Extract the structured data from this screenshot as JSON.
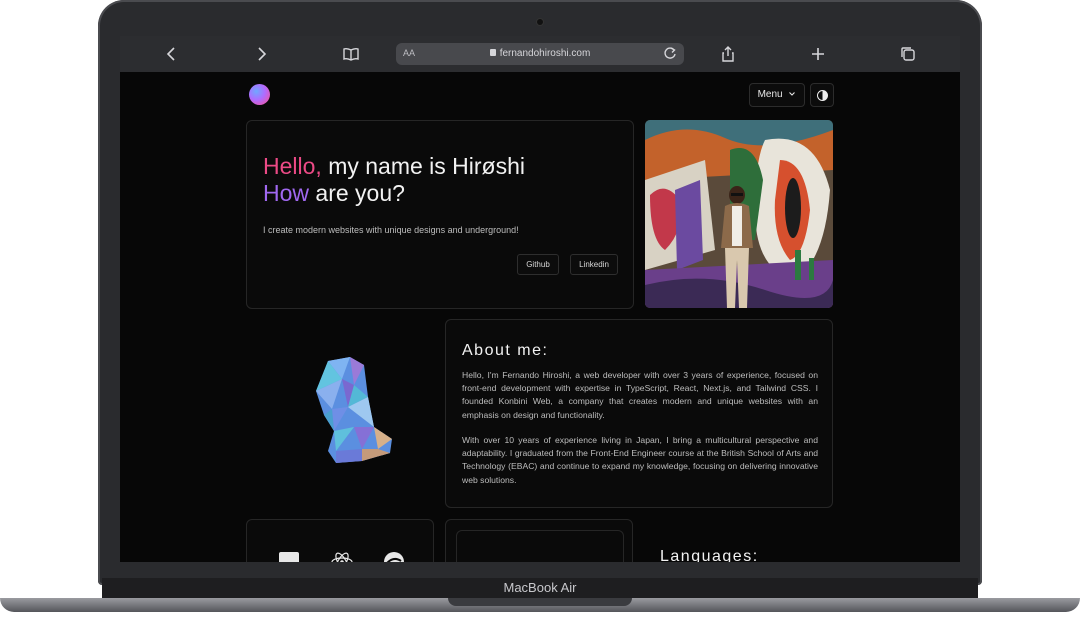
{
  "device": {
    "label": "MacBook Air"
  },
  "browser": {
    "text_size_label": "AA",
    "url": "fernandohiroshi.com",
    "icons": [
      "chevron-left-icon",
      "chevron-right-icon",
      "book-icon",
      "lock-icon",
      "reload-icon",
      "share-icon",
      "plus-icon",
      "tabs-icon"
    ]
  },
  "nav": {
    "menu_label": "Menu",
    "menu_caret": "⌄"
  },
  "hero": {
    "line1_accent": "Hello,",
    "line1_rest": " my name is Hirøshi",
    "line2_accent": "How",
    "line2_rest": " are you?",
    "subtitle": "I create modern websites with unique designs and underground!",
    "buttons": {
      "github": "Github",
      "linkedin": "Linkedin"
    }
  },
  "about": {
    "title": "About me:",
    "paragraph1": "Hello, I'm Fernando Hiroshi, a web developer with over 3 years of experience, focused on front-end development with expertise in TypeScript, React, Next.js, and Tailwind CSS. I founded Konbini Web, a company that creates modern and unique websites with an emphasis on design and functionality.",
    "paragraph2": "With over 10 years of experience living in Japan, I bring a multicultural perspective and adaptability. I graduated from the Front-End Engineer course at the British School of Arts and Technology (EBAC) and continue to expand my knowledge, focusing on delivering innovative web solutions."
  },
  "languages": {
    "title": "Languages:"
  },
  "colors": {
    "accent_pink": "#ec4a86",
    "accent_purple": "#a068f0",
    "background": "#070707"
  }
}
